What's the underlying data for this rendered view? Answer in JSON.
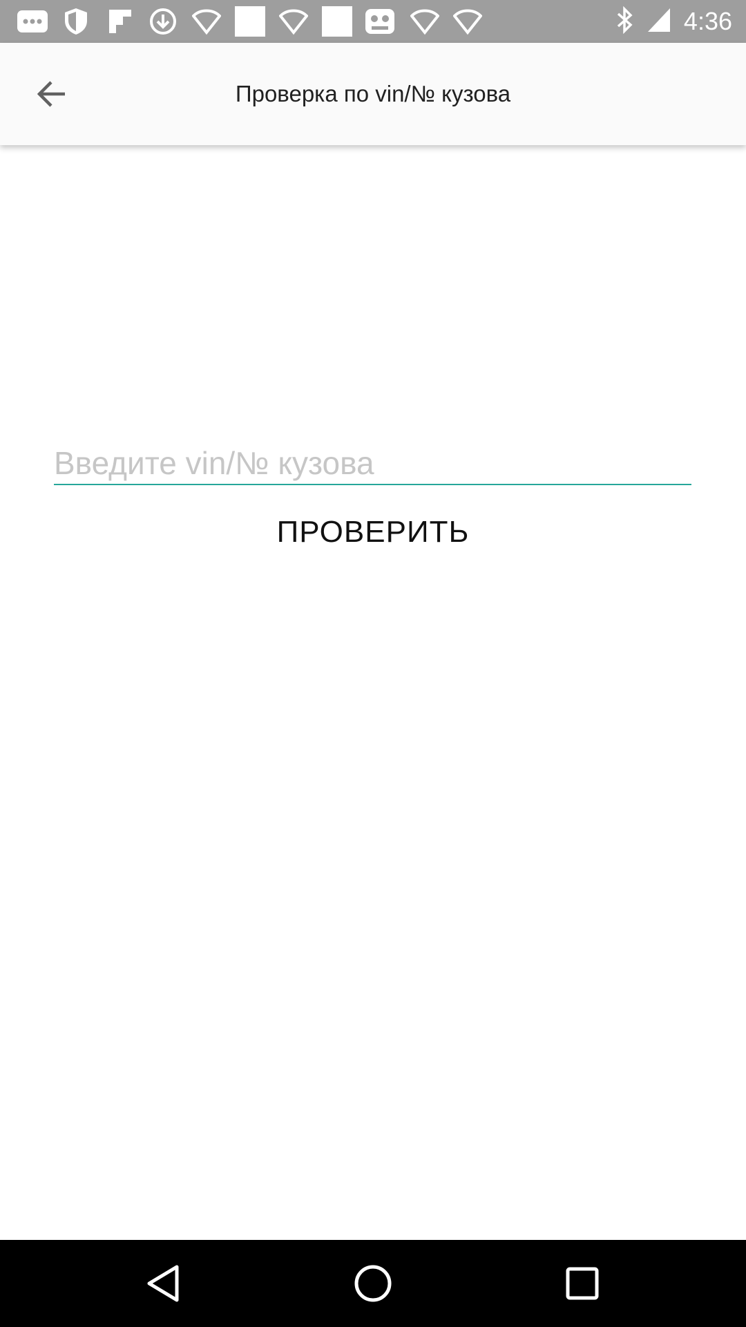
{
  "status_bar": {
    "time": "4:36",
    "icons": [
      "more-notifications-icon",
      "shield-icon",
      "flipboard-icon",
      "download-icon",
      "wifi-icon",
      "square-icon",
      "wifi-icon",
      "square-icon",
      "game-icon",
      "wifi-icon",
      "wifi-icon",
      "bluetooth-icon",
      "signal-icon"
    ]
  },
  "app_bar": {
    "title": "Проверка по vin/№ кузова"
  },
  "form": {
    "vin_placeholder": "Введите vin/№ кузова",
    "vin_value": "",
    "check_button_label": "ПРОВЕРИТЬ",
    "accent_color": "#26a69a"
  },
  "nav_bar": {
    "buttons": [
      "back-triangle-icon",
      "home-circle-icon",
      "recents-square-icon"
    ]
  }
}
